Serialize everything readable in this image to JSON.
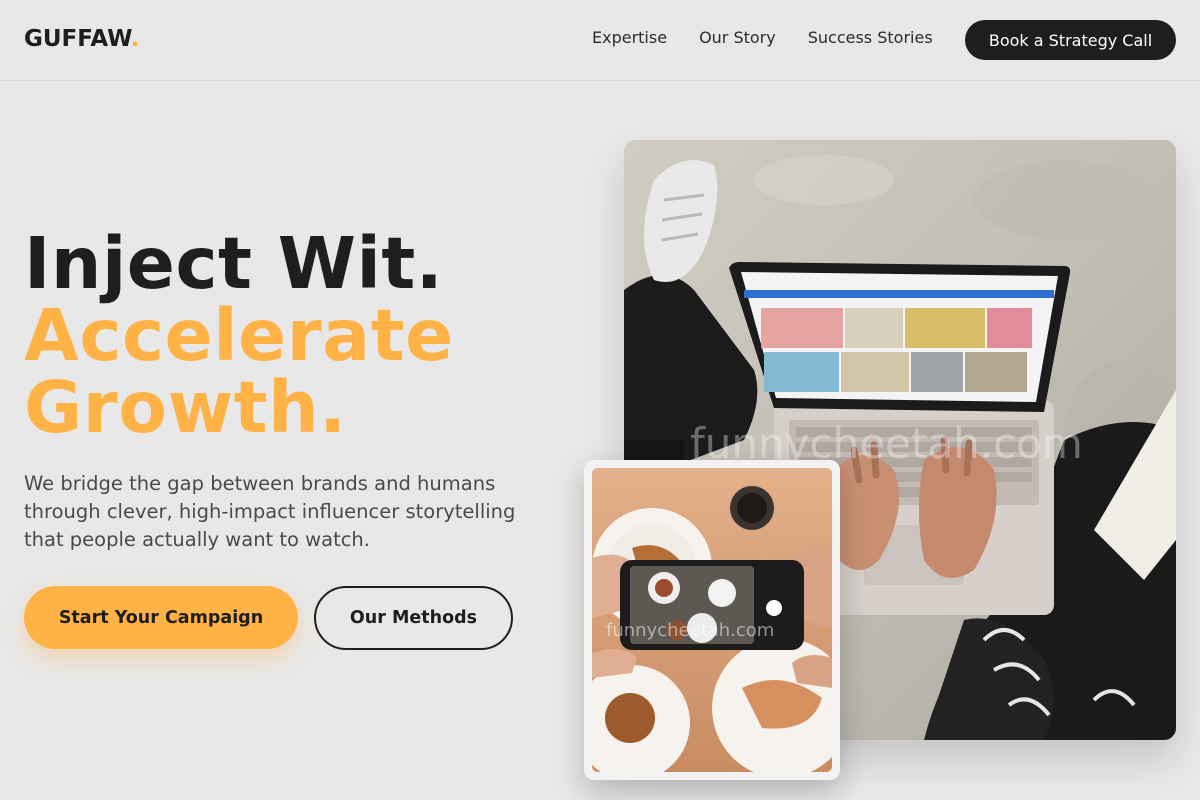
{
  "header": {
    "logo_text": "GUFFAW",
    "logo_dot": ".",
    "nav": [
      {
        "label": "Expertise"
      },
      {
        "label": "Our Story"
      },
      {
        "label": "Success Stories"
      }
    ],
    "cta_label": "Book a Strategy Call"
  },
  "hero": {
    "headline_line1": "Inject Wit.",
    "headline_line2": "Accelerate",
    "headline_line3": "Growth.",
    "subcopy": "We bridge the gap between brands and humans through clever, high-impact influencer storytelling that people actually want to watch.",
    "primary_button": "Start Your Campaign",
    "secondary_button": "Our Methods"
  },
  "images": {
    "main_watermark": "funnycheetah.com",
    "sub_watermark": "funnycheetah.com"
  },
  "colors": {
    "accent": "#ffb347",
    "dark": "#1e1e1e",
    "background": "#e8e8e8"
  }
}
